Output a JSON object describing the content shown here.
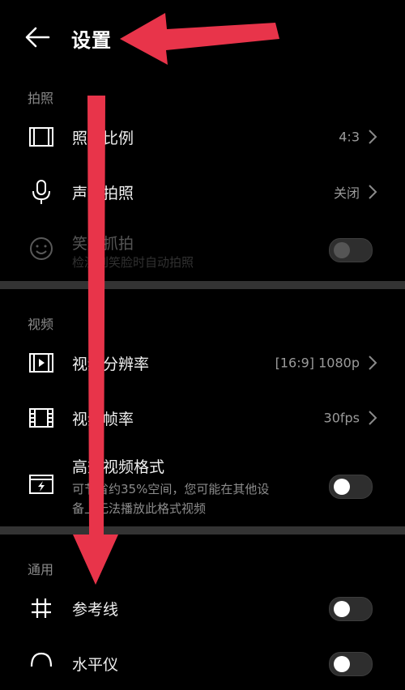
{
  "header": {
    "title": "设置"
  },
  "sections": {
    "photo": "拍照",
    "video": "视频",
    "general": "通用"
  },
  "rows": {
    "aspect_ratio": {
      "title": "照片比例",
      "value": "4:3"
    },
    "voice_shot": {
      "title": "声控拍照",
      "value": "关闭"
    },
    "smile_shot": {
      "title": "笑脸抓拍",
      "sub": "检测到笑脸时自动拍照",
      "enabled": false
    },
    "video_resolution": {
      "title": "视频分辨率",
      "value": "[16:9] 1080p"
    },
    "frame_rate": {
      "title": "视频帧率",
      "value": "30fps"
    },
    "efficient_format": {
      "title": "高效视频格式",
      "sub1": "可节省约35%空间，您可能在其他设",
      "sub2": "备上无法播放此格式视频",
      "enabled": false
    },
    "grid": {
      "title": "参考线",
      "enabled": false
    },
    "level": {
      "title": "水平仪",
      "enabled": false
    }
  },
  "colors": {
    "background": "#000000",
    "annotation_arrow": "#e8344a",
    "secondary_text": "#8c8c8c"
  }
}
